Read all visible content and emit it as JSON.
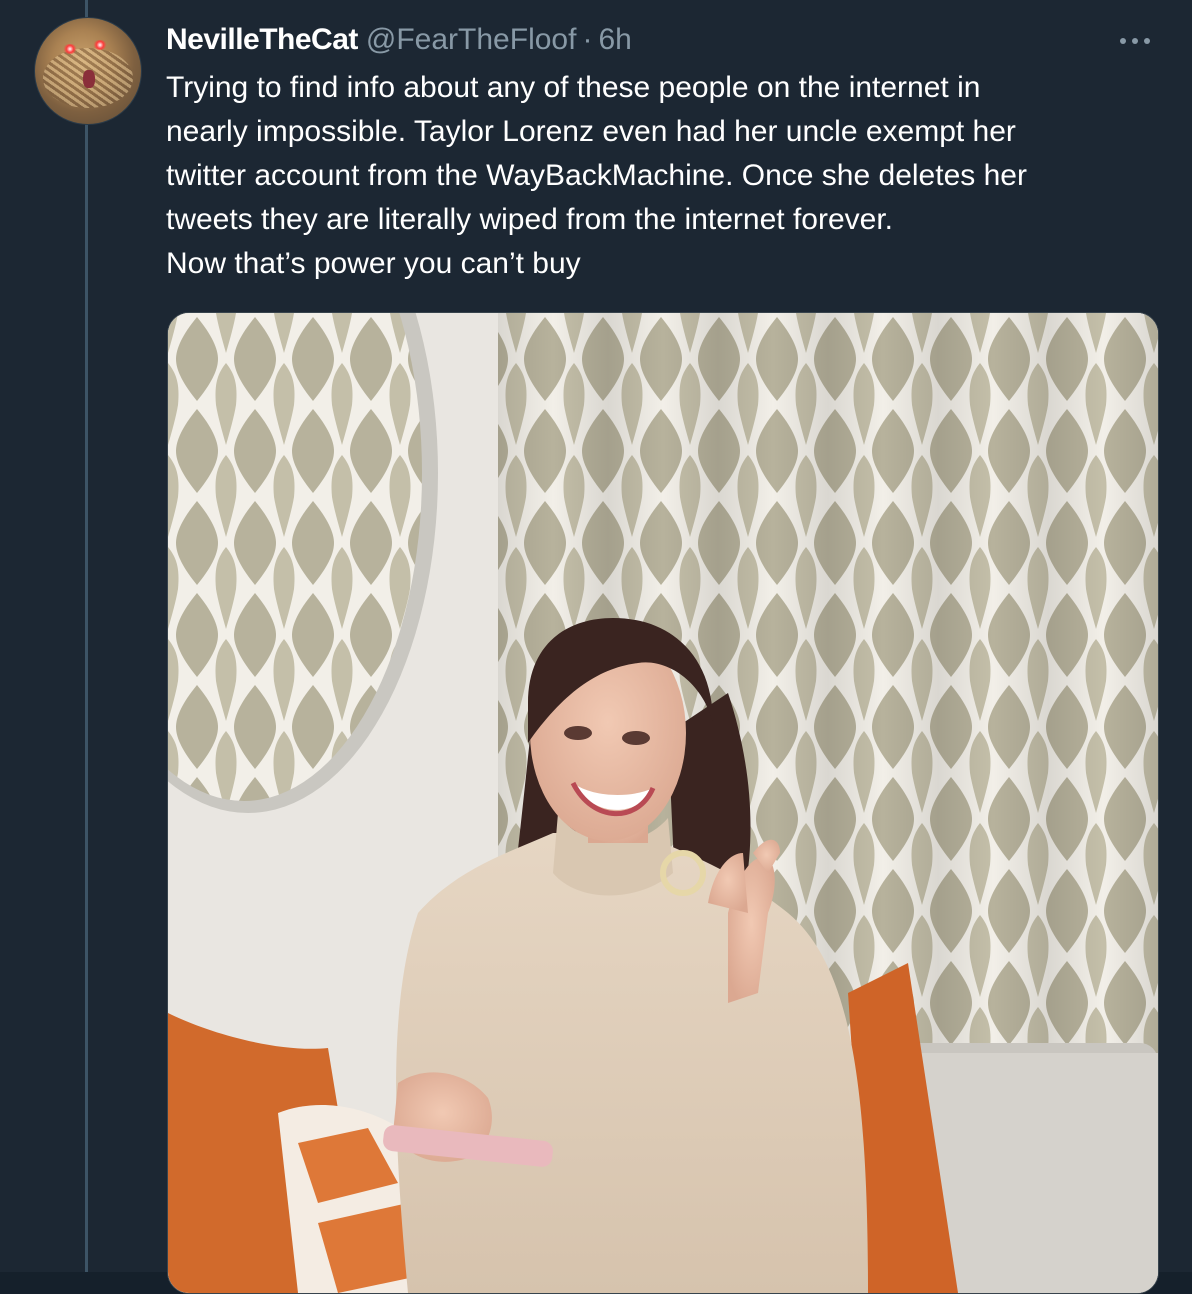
{
  "tweet": {
    "display_name": "NevilleTheCat",
    "handle": "@FearTheFloof",
    "separator": "·",
    "time": "6h",
    "text_lines": [
      "Trying to find info about any of these people on the internet in",
      "nearly impossible. Taylor Lorenz even had her uncle exempt her",
      "twitter account from the WayBackMachine. Once she deletes her",
      "tweets they are literally wiped from the internet forever.",
      "Now that’s power you can’t buy"
    ],
    "more_icon": "more-horizontal-icon"
  },
  "colors": {
    "background": "#1c2733",
    "secondary_text": "#8899a6",
    "primary_text": "#ffffff",
    "thread_line": "#3d5466"
  }
}
